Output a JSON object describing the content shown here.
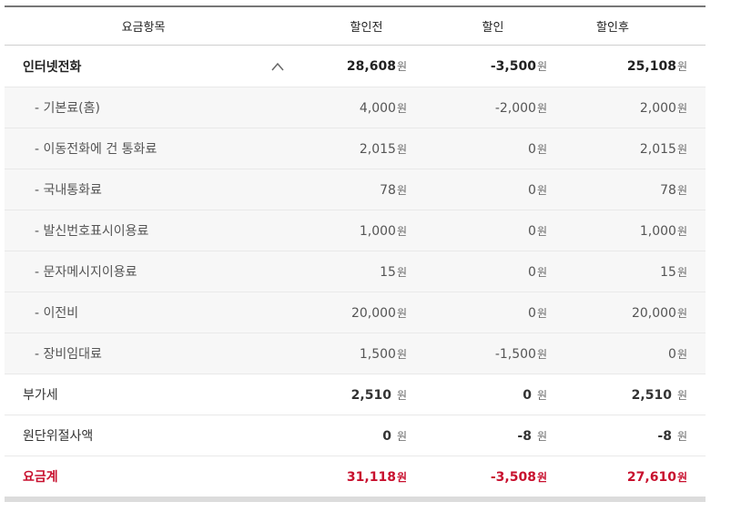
{
  "headers": [
    "요금항목",
    "할인전",
    "할인",
    "할인후"
  ],
  "unit": "원",
  "section": {
    "name": "인터넷전화",
    "values": [
      "28,608",
      "-3,500",
      "25,108"
    ]
  },
  "items": [
    {
      "label": "- 기본료(홈)",
      "values": [
        "4,000",
        "-2,000",
        "2,000"
      ]
    },
    {
      "label": "- 이동전화에 건 통화료",
      "values": [
        "2,015",
        "0",
        "2,015"
      ]
    },
    {
      "label": "- 국내통화료",
      "values": [
        "78",
        "0",
        "78"
      ]
    },
    {
      "label": "- 발신번호표시이용료",
      "values": [
        "1,000",
        "0",
        "1,000"
      ]
    },
    {
      "label": "- 문자메시지이용료",
      "values": [
        "15",
        "0",
        "15"
      ]
    },
    {
      "label": "- 이전비",
      "values": [
        "20,000",
        "0",
        "20,000"
      ]
    },
    {
      "label": "- 장비임대료",
      "values": [
        "1,500",
        "-1,500",
        "0"
      ]
    }
  ],
  "vat": {
    "label": "부가세",
    "values": [
      "2,510",
      "0",
      "2,510"
    ]
  },
  "rounding": {
    "label": "원단위절사액",
    "values": [
      "0",
      "-8",
      "-8"
    ]
  },
  "total": {
    "label": "요금계",
    "values": [
      "31,118",
      "-3,508",
      "27,610"
    ]
  },
  "colors": {
    "total": "#c8102e",
    "sub_bg": "#f7f7f7"
  }
}
